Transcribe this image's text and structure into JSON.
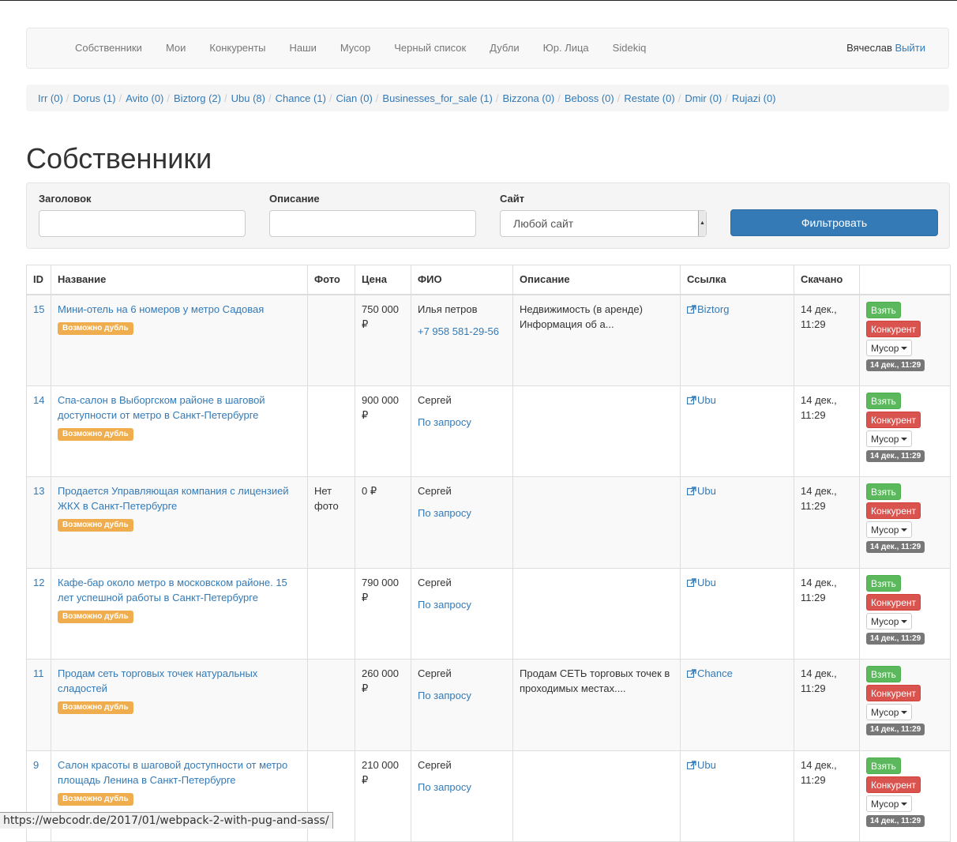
{
  "nav": {
    "items": [
      "Собственники",
      "Мои",
      "Конкуренты",
      "Наши",
      "Мусор",
      "Черный список",
      "Дубли",
      "Юр. Лица",
      "Sidekiq"
    ],
    "user_name": "Вячеслав",
    "logout_label": "Выйти"
  },
  "sources": [
    "Irr (0)",
    "Dorus (1)",
    "Avito (0)",
    "Biztorg (2)",
    "Ubu (8)",
    "Chance (1)",
    "Cian (0)",
    "Businesses_for_sale (1)",
    "Bizzona (0)",
    "Beboss (0)",
    "Restate (0)",
    "Dmir (0)",
    "Rujazi (0)"
  ],
  "page_title": "Собственники",
  "filter": {
    "title_label": "Заголовок",
    "title_value": "",
    "description_label": "Описание",
    "description_value": "",
    "site_label": "Сайт",
    "site_selected": "Любой сайт",
    "submit_label": "Фильтровать"
  },
  "table": {
    "headers": [
      "ID",
      "Название",
      "Фото",
      "Цена",
      "ФИО",
      "Описание",
      "Ссылка",
      "Скачано",
      ""
    ],
    "rows": [
      {
        "id": "15",
        "name": "Мини-отель на 6 номеров у метро Садовая",
        "badge": "Возможно дубль",
        "photo": "",
        "price": "750 000 ₽",
        "person": "Илья петров",
        "contact": "+7 958 581-29-56",
        "description": "Недвижимость (в аренде) Информация об а...",
        "link": "Biztorg",
        "downloaded": "14 дек., 11:29",
        "take": "Взять",
        "competitor": "Конкурент",
        "trash": "Мусор",
        "timestamp": "14 дек., 11:29"
      },
      {
        "id": "14",
        "name": "Спа-салон в Выборгском районе в шаговой доступности от метро в Санкт-Петербурге",
        "badge": "Возможно дубль",
        "photo": "",
        "price": "900 000 ₽",
        "person": "Сергей",
        "contact": "По запросу",
        "description": "",
        "link": "Ubu",
        "downloaded": "14 дек., 11:29",
        "take": "Взять",
        "competitor": "Конкурент",
        "trash": "Мусор",
        "timestamp": "14 дек., 11:29"
      },
      {
        "id": "13",
        "name": "Продается Управляющая компания с лицензией ЖКХ в Санкт-Петербурге",
        "badge": "Возможно дубль",
        "photo": "Нет фото",
        "price": "0 ₽",
        "person": "Сергей",
        "contact": "По запросу",
        "description": "",
        "link": "Ubu",
        "downloaded": "14 дек., 11:29",
        "take": "Взять",
        "competitor": "Конкурент",
        "trash": "Мусор",
        "timestamp": "14 дек., 11:29"
      },
      {
        "id": "12",
        "name": "Кафе-бар около метро в московском районе. 15 лет успешной работы в Санкт-Петербурге",
        "badge": "Возможно дубль",
        "photo": "",
        "price": "790 000 ₽",
        "person": "Сергей",
        "contact": "По запросу",
        "description": "",
        "link": "Ubu",
        "downloaded": "14 дек., 11:29",
        "take": "Взять",
        "competitor": "Конкурент",
        "trash": "Мусор",
        "timestamp": "14 дек., 11:29"
      },
      {
        "id": "11",
        "name": "Продам сеть торговых точек натуральных сладостей",
        "badge": "Возможно дубль",
        "photo": "",
        "price": "260 000 ₽",
        "person": "Сергей",
        "contact": "По запросу",
        "description": "Продам СЕТЬ торговых точек в проходимых местах....",
        "link": "Chance",
        "downloaded": "14 дек., 11:29",
        "take": "Взять",
        "competitor": "Конкурент",
        "trash": "Мусор",
        "timestamp": "14 дек., 11:29"
      },
      {
        "id": "9",
        "name": "Салон красоты в шаговой доступности от метро площадь Ленина в Санкт-Петербурге",
        "badge": "Возможно дубль",
        "photo": "",
        "price": "210 000 ₽",
        "person": "Сергей",
        "contact": "По запросу",
        "description": "",
        "link": "Ubu",
        "downloaded": "14 дек., 11:29",
        "take": "Взять",
        "competitor": "Конкурент",
        "trash": "Мусор",
        "timestamp": "14 дек., 11:29"
      }
    ]
  },
  "status_url": "https://webcodr.de/2017/01/webpack-2-with-pug-and-sass/",
  "colors": {
    "link": "#337ab7",
    "primary": "#337ab7",
    "success": "#5cb85c",
    "danger": "#d9534f",
    "warning": "#f0ad4e",
    "muted": "#777777"
  }
}
